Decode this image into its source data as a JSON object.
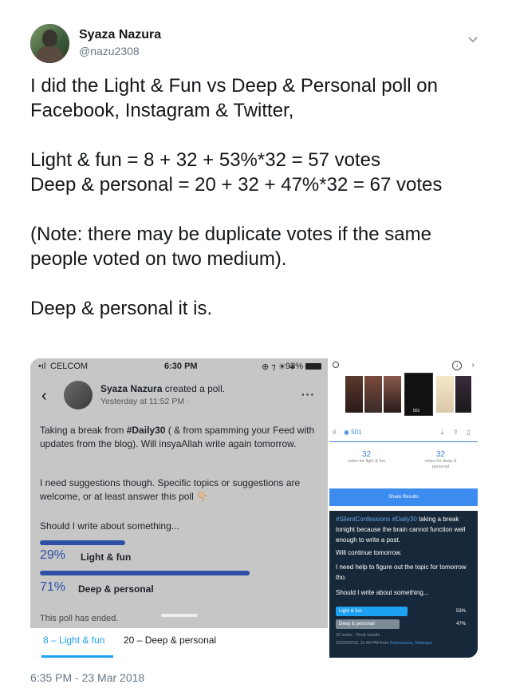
{
  "tweet": {
    "author_name": "Syaza Nazura",
    "author_handle": "@nazu2308",
    "text": "I did the Light & Fun vs Deep & Personal poll on Facebook, Instagram & Twitter,\n\nLight & fun = 8 + 32 + 53%*32 = 57 votes\nDeep & personal = 20 + 32 + 47%*32 = 67 votes\n\n(Note: there may be duplicate votes if the same people voted on two medium).\n\nDeep & personal it is.",
    "timestamp": "6:35 PM - 23 Mar 2018"
  },
  "facebook_screenshot": {
    "status": {
      "carrier": "CELCOM",
      "time": "6:30 PM",
      "battery": "93%"
    },
    "poster_name": "Syaza Nazura",
    "action": "created a poll.",
    "post_time": "Yesterday at 11:52 PM ·",
    "paragraph1_prefix": "Taking a break from ",
    "hashtag": "#Daily30",
    "paragraph1_suffix": " ( & from spamming your Feed with updates from the blog). Will insyaAllah write again tomorrow.",
    "paragraph2": "I need suggestions though. Specific topics or suggestions are welcome, or at least answer this poll 👇🏼",
    "question": "Should I write about something...",
    "options": [
      {
        "pct": "29%",
        "label": "Light & fun",
        "fraction": 0.29
      },
      {
        "pct": "71%",
        "label": "Deep & personal",
        "fraction": 0.71
      }
    ],
    "ended": "This poll has ended.",
    "tabs": [
      "8 – Light & fun",
      "20 – Deep & personal"
    ]
  },
  "instagram_screenshot": {
    "views_badge": "501",
    "stat1_value": "32",
    "stat1_label": "votes for light & fun",
    "stat2_value": "32",
    "stat2_label": "votes for deep & personal",
    "share_label": "Share Results"
  },
  "twitter_screenshot": {
    "hashtags": "#SilentConfessions #Daily30",
    "line1_suffix": " taking a break tonight because the brain cannot function well enough to write a post.",
    "line2": "Will continue tomorrow.",
    "line3": "I need help to figure out the topic for tomorrow tho.",
    "line4": "Should I write about something...",
    "options": [
      {
        "label": "Light & fun",
        "pct": "53%",
        "fraction": 0.53
      },
      {
        "label": "Deep & personal",
        "pct": "47%",
        "fraction": 0.47
      }
    ],
    "meta1": "32 votes · Final results",
    "meta2_prefix": "22/03/2018, 11:49 PM from ",
    "meta2_link": "Damansara, Selangor"
  },
  "colors": {
    "accent": "#1da1f2",
    "fb_poll": "#2d4fa6",
    "tw_bar": "#1da1f2",
    "tw_bar_loser": "#7d8b99"
  }
}
